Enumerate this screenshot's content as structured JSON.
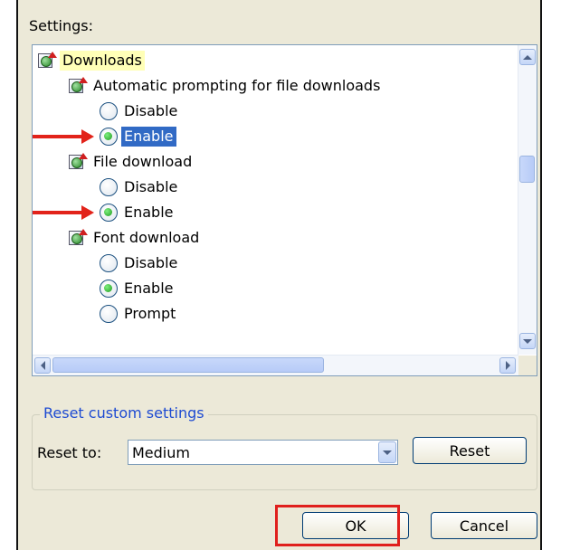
{
  "settings_label": "Settings:",
  "tree": [
    {
      "kind": "category",
      "label": "Downloads",
      "icon": "globe-settings-icon"
    },
    {
      "kind": "setting",
      "label": "Automatic prompting for file downloads",
      "icon": "globe-settings-icon"
    },
    {
      "kind": "option",
      "label": "Disable",
      "checked": false
    },
    {
      "kind": "option",
      "label": "Enable",
      "checked": true,
      "selected": true
    },
    {
      "kind": "setting",
      "label": "File download",
      "icon": "globe-settings-icon"
    },
    {
      "kind": "option",
      "label": "Disable",
      "checked": false
    },
    {
      "kind": "option",
      "label": "Enable",
      "checked": true
    },
    {
      "kind": "setting",
      "label": "Font download",
      "icon": "globe-settings-icon"
    },
    {
      "kind": "option",
      "label": "Disable",
      "checked": false
    },
    {
      "kind": "option",
      "label": "Enable",
      "checked": true
    },
    {
      "kind": "option",
      "label": "Prompt",
      "checked": false
    }
  ],
  "reset_group": {
    "legend": "Reset custom settings",
    "reset_to_label": "Reset to:",
    "reset_to_value": "Medium",
    "reset_button": "Reset"
  },
  "buttons": {
    "ok": "OK",
    "cancel": "Cancel"
  },
  "colors": {
    "highlight_border": "#e0201d",
    "arrow": "#e2231a",
    "selection": "#316ac5",
    "legend_text": "#1e4bd2"
  }
}
